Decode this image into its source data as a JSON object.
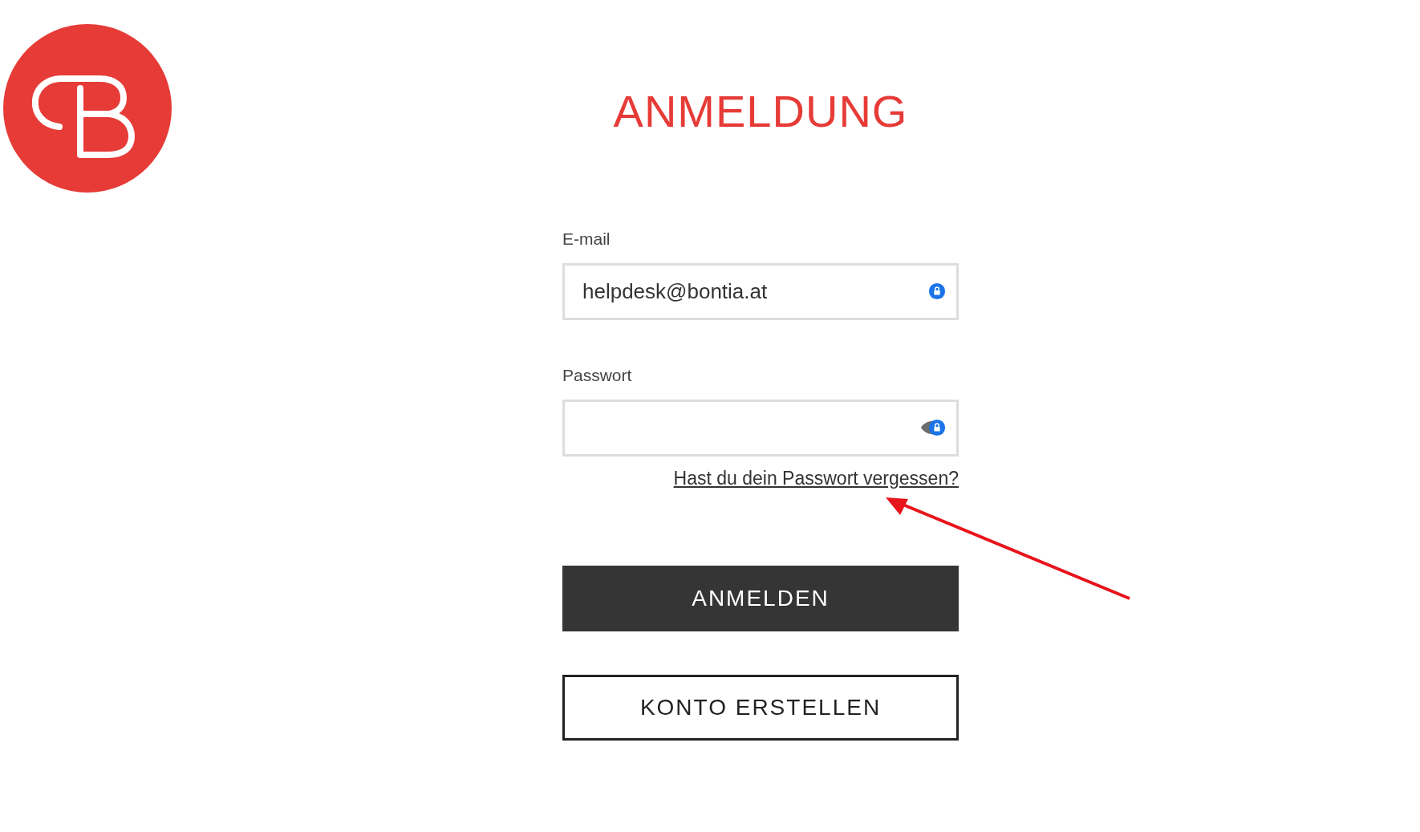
{
  "title": "ANMELDUNG",
  "fields": [
    {
      "label": "E-mail",
      "value": "helpdesk@bontia.at",
      "kind": "email"
    },
    {
      "label": "Passwort",
      "kind": "password"
    }
  ],
  "forgot_link": "Hast du dein Passwort vergessen?",
  "buttons": [
    {
      "label": "ANMELDEN",
      "kind": "primary"
    },
    {
      "label": "KONTO ERSTELLEN",
      "kind": "secondary"
    }
  ]
}
